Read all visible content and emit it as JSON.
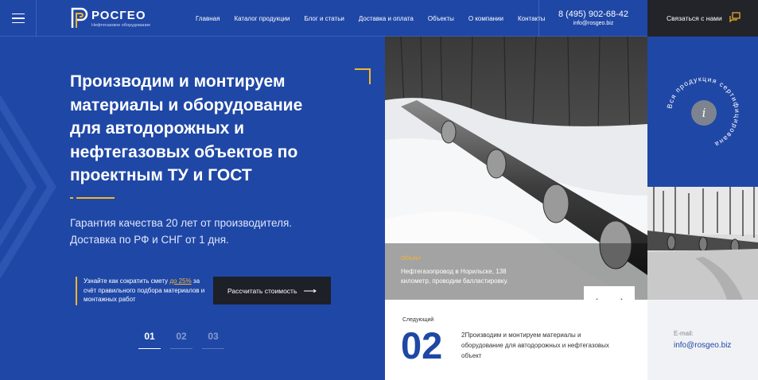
{
  "header": {
    "logo_text": "РОСГЕО",
    "logo_subtitle": "Нефтегазовое оборудование",
    "nav": [
      "Главная",
      "Каталог продукции",
      "Блог и статьи",
      "Доставка и оплата",
      "Объекты",
      "О компании",
      "Контакты"
    ],
    "phone": "8 (495) 902-68-42",
    "email": "info@rosgeo.biz",
    "contact_button": "Связаться с нами"
  },
  "hero": {
    "title": "Производим и монтируем материалы и оборудование для автодорожных и нефтегазовых объектов по проектным ТУ и ГОСТ",
    "subtitle": "Гарантия качества 20 лет от производителя. Доставка по РФ и СНГ от 1 дня.",
    "promo_before": "Узнайте как сократить смету ",
    "promo_highlight": "до 25%",
    "promo_after": " за счёт правильного подбора материалов и монтажных работ",
    "calc_button": "Рассчитать стоимость",
    "slides": [
      "01",
      "02",
      "03"
    ]
  },
  "photo": {
    "label": "Объект",
    "caption": "Нефтегазопровод в Норильске, 138 километр, проводим балластировку.",
    "prev": "‹",
    "next": "›"
  },
  "next_slide": {
    "label": "Следующий",
    "number": "02",
    "text": "2Производим и монтируем материалы и оборудование для автодорожных и нефтегазовых объект"
  },
  "badge": {
    "ring_text": "Вся продукция сертифицирована",
    "info": "i"
  },
  "side_contact": {
    "label": "E-mail:",
    "email": "info@rosgeo.biz"
  },
  "colors": {
    "brand_blue": "#1f47a6",
    "accent_yellow": "#f4b62b",
    "dark": "#222429"
  }
}
